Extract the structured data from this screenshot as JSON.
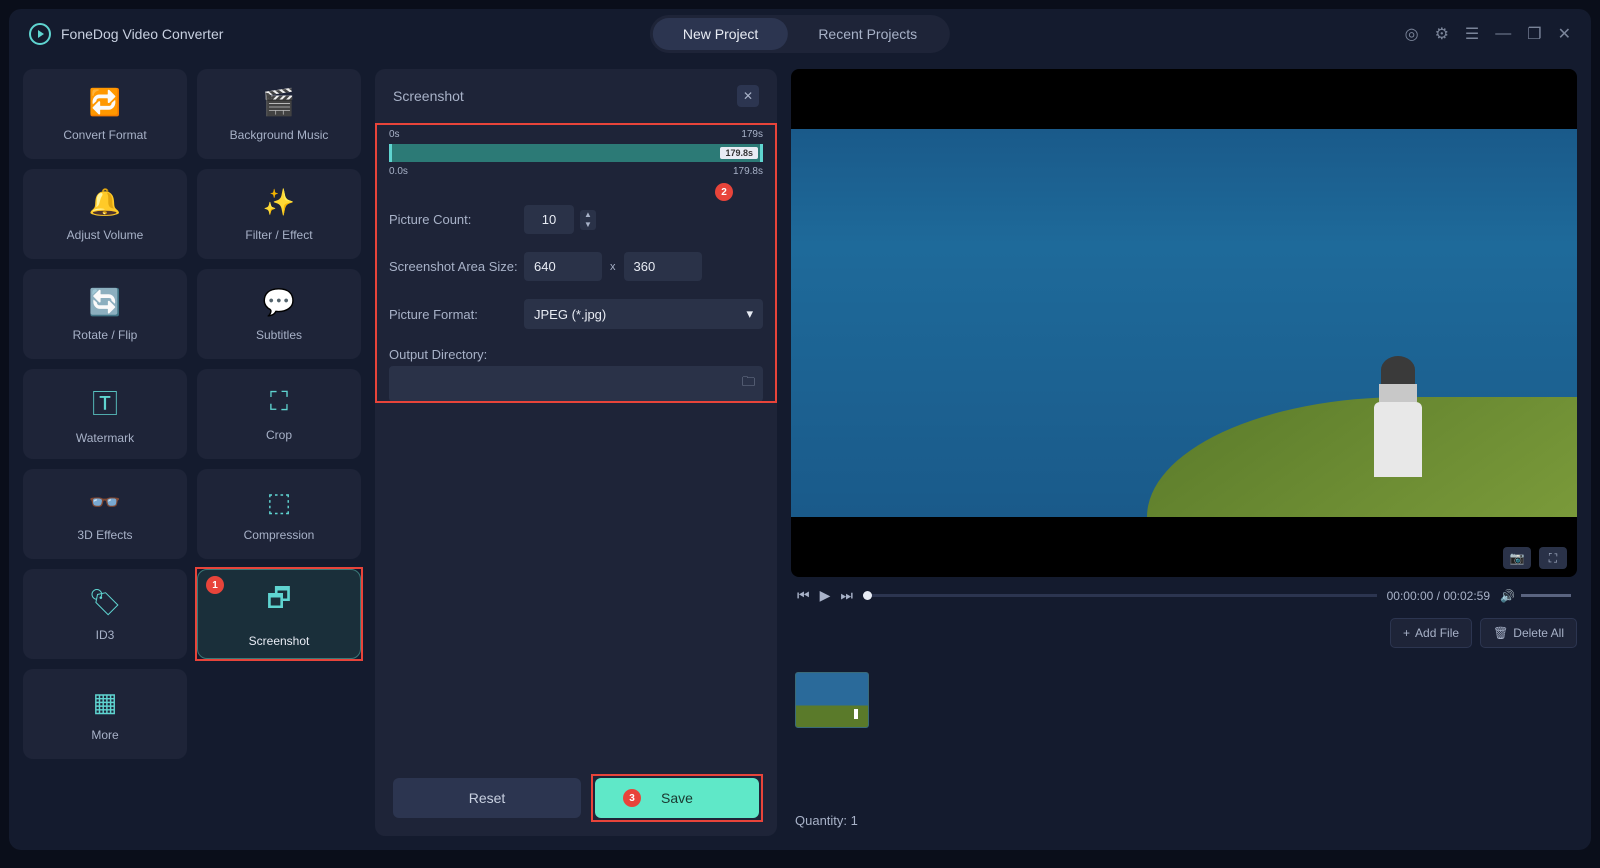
{
  "app": {
    "title": "FoneDog Video Converter"
  },
  "tabs": {
    "new_project": "New Project",
    "recent_projects": "Recent Projects"
  },
  "tools": {
    "convert_format": "Convert Format",
    "background_music": "Background Music",
    "adjust_volume": "Adjust Volume",
    "filter_effect": "Filter / Effect",
    "rotate_flip": "Rotate / Flip",
    "subtitles": "Subtitles",
    "watermark": "Watermark",
    "crop": "Crop",
    "3d_effects": "3D Effects",
    "compression": "Compression",
    "id3": "ID3",
    "screenshot": "Screenshot",
    "more": "More"
  },
  "settings": {
    "title": "Screenshot",
    "timeline": {
      "start": "0s",
      "end": "179s",
      "low": "0.0s",
      "high": "179.8s",
      "bubble": "179.8s"
    },
    "picture_count_label": "Picture Count:",
    "picture_count_value": "10",
    "area_size_label": "Screenshot Area Size:",
    "area_w": "640",
    "x_sep": "x",
    "area_h": "360",
    "picture_format_label": "Picture Format:",
    "picture_format_value": "JPEG (*.jpg)",
    "output_dir_label": "Output Directory:",
    "reset": "Reset",
    "save": "Save"
  },
  "badges": {
    "b1": "1",
    "b2": "2",
    "b3": "3"
  },
  "player": {
    "time": "00:00:00 / 00:02:59"
  },
  "files": {
    "add_file": "Add File",
    "delete_all": "Delete All",
    "quantity": "Quantity: 1"
  }
}
